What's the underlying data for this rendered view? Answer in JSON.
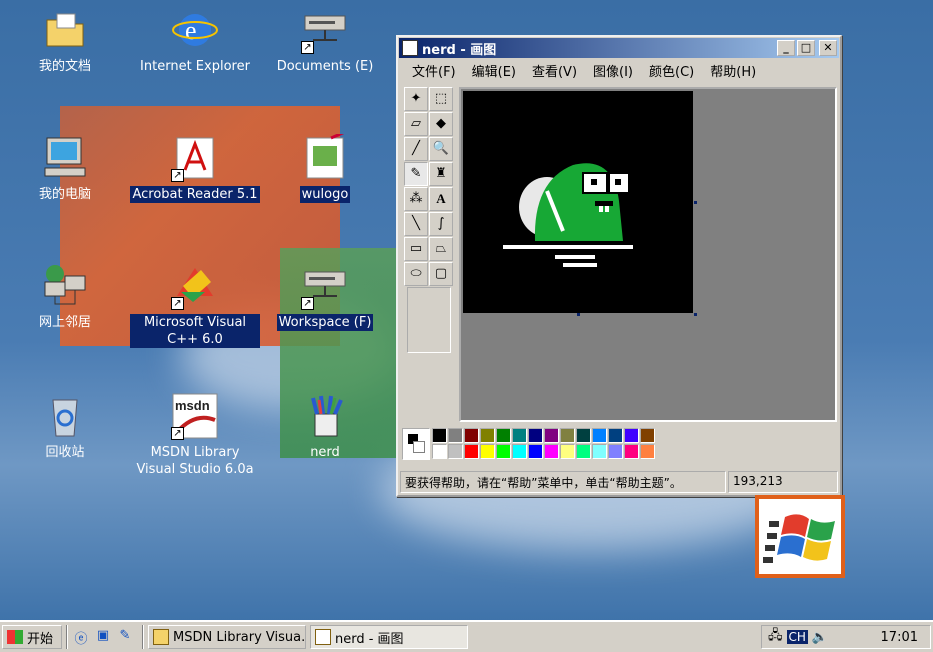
{
  "desktop": {
    "icons": [
      {
        "name": "my-documents",
        "label": "我的文档",
        "selected": false,
        "shortcut": false
      },
      {
        "name": "internet-explorer",
        "label": "Internet Explorer",
        "selected": false,
        "shortcut": false
      },
      {
        "name": "documents-e",
        "label": "Documents (E)",
        "selected": false,
        "shortcut": true
      },
      {
        "name": "my-computer",
        "label": "我的电脑",
        "selected": false,
        "shortcut": false
      },
      {
        "name": "acrobat-reader",
        "label": "Acrobat Reader 5.1",
        "selected": true,
        "shortcut": true
      },
      {
        "name": "wulogo",
        "label": "wulogo",
        "selected": true,
        "shortcut": false
      },
      {
        "name": "network-neighborhood",
        "label": "网上邻居",
        "selected": false,
        "shortcut": false
      },
      {
        "name": "visual-cpp",
        "label": "Microsoft Visual C++ 6.0",
        "selected": true,
        "shortcut": true
      },
      {
        "name": "workspace-f",
        "label": "Workspace (F)",
        "selected": true,
        "shortcut": true
      },
      {
        "name": "recycle-bin",
        "label": "回收站",
        "selected": false,
        "shortcut": false
      },
      {
        "name": "msdn-library",
        "label": "MSDN Library Visual Studio 6.0a",
        "selected": false,
        "shortcut": true
      },
      {
        "name": "nerd",
        "label": "nerd",
        "selected": false,
        "shortcut": false
      }
    ]
  },
  "paint": {
    "title": "nerd - 画图",
    "menu": [
      "文件(F)",
      "编辑(E)",
      "查看(V)",
      "图像(I)",
      "颜色(C)",
      "帮助(H)"
    ],
    "tools": [
      "free-select",
      "rect-select",
      "eraser",
      "fill",
      "eyedropper",
      "magnifier",
      "pencil",
      "brush",
      "airbrush",
      "text",
      "line",
      "curve",
      "rectangle",
      "polygon",
      "ellipse",
      "rounded-rect"
    ],
    "palette_top": [
      "#000000",
      "#808080",
      "#800000",
      "#808000",
      "#008000",
      "#008080",
      "#000080",
      "#800080",
      "#808040",
      "#004040",
      "#0080ff",
      "#004080",
      "#4000ff",
      "#804000"
    ],
    "palette_bottom": [
      "#ffffff",
      "#c0c0c0",
      "#ff0000",
      "#ffff00",
      "#00ff00",
      "#00ffff",
      "#0000ff",
      "#ff00ff",
      "#ffff80",
      "#00ff80",
      "#80ffff",
      "#8080ff",
      "#ff0080",
      "#ff8040"
    ],
    "status_msg": "要获得帮助，请在“帮助”菜单中，单击“帮助主题”。",
    "status_coord": "193,213"
  },
  "taskbar": {
    "start": "开始",
    "tasks": [
      {
        "label": "MSDN Library Visua...",
        "active": false
      },
      {
        "label": "nerd - 画图",
        "active": true
      }
    ],
    "lang": "CH",
    "clock": "17:01"
  }
}
